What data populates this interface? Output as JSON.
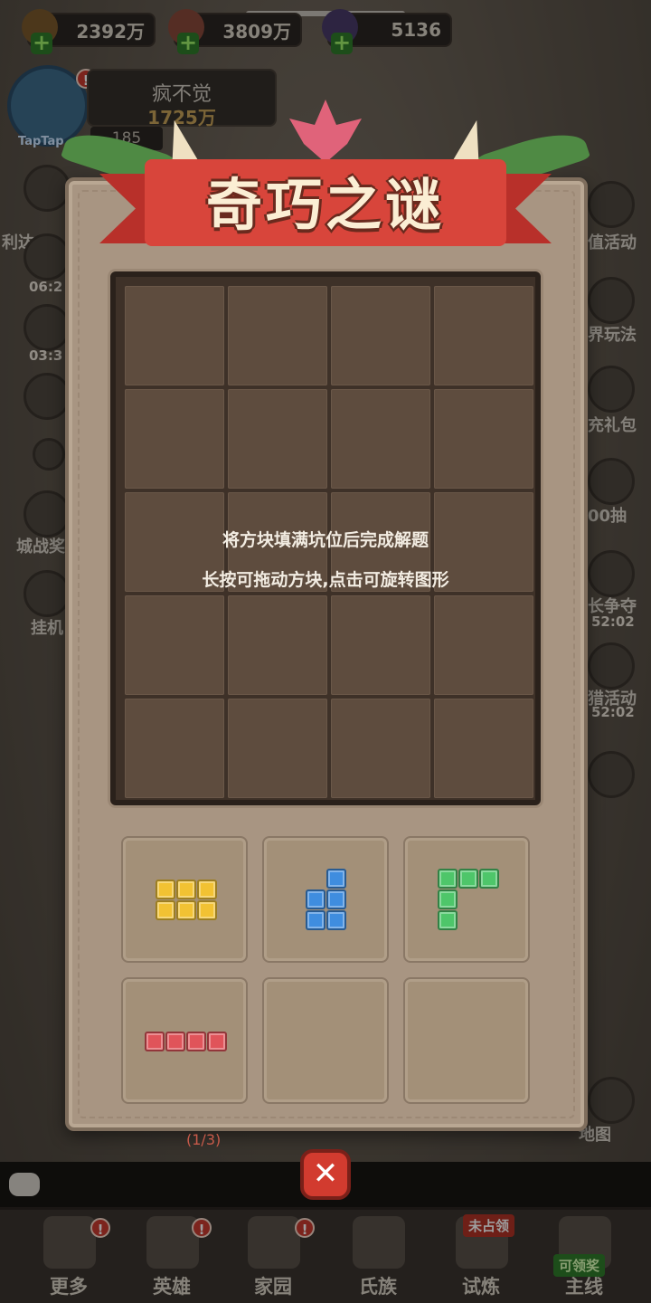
{
  "resources": [
    {
      "icon": "wheat-icon",
      "value": "2392万"
    },
    {
      "icon": "meat-icon",
      "value": "3809万"
    },
    {
      "icon": "gem-icon",
      "value": "5136"
    }
  ],
  "player": {
    "name": "疯不觉",
    "power": "1725万",
    "level": "185",
    "tag": "TapTap"
  },
  "left_side": [
    {
      "label": "利达",
      "time": "06:2"
    },
    {
      "label": "",
      "time": "03:3"
    },
    {
      "label": "城战奖",
      "time": ""
    },
    {
      "label": "挂机",
      "time": ""
    }
  ],
  "right_side": [
    {
      "label": "值活动"
    },
    {
      "label": "界玩法"
    },
    {
      "label": "充礼包"
    },
    {
      "label": "00抽"
    },
    {
      "label": "长争夺",
      "time": "52:02"
    },
    {
      "label": "猎活动",
      "time": "52:02"
    },
    {
      "label": "地图"
    }
  ],
  "puzzle": {
    "title": "奇巧之谜",
    "hint_line1": "将方块填满坑位后完成解题",
    "hint_line2": "长按可拖动方块,点击可旋转图形",
    "board_rows": 5,
    "board_cols": 4,
    "pieces": [
      {
        "color": "yellow",
        "shape": "2x3 rectangle"
      },
      {
        "color": "blue",
        "shape": "J"
      },
      {
        "color": "green",
        "shape": "L"
      },
      {
        "color": "red",
        "shape": "I4"
      },
      {
        "color": "",
        "shape": "empty"
      },
      {
        "color": "",
        "shape": "empty"
      }
    ],
    "progress": "(1/3)"
  },
  "close_label": "✕",
  "nav": [
    {
      "label": "更多",
      "badge": "!"
    },
    {
      "label": "英雄",
      "badge": "!"
    },
    {
      "label": "家园",
      "badge": "!"
    },
    {
      "label": "氏族",
      "badge": ""
    },
    {
      "label": "试炼",
      "tag": "未占领"
    },
    {
      "label": "主线",
      "tag": "可领奖"
    }
  ],
  "colors": {
    "modal_bg": "#a89582",
    "board_bg": "#3e3128",
    "banner_red": "#d8453b",
    "yellow": "#f2c233",
    "blue": "#3f8ddf",
    "green": "#4ec66a",
    "red": "#e0545a"
  }
}
